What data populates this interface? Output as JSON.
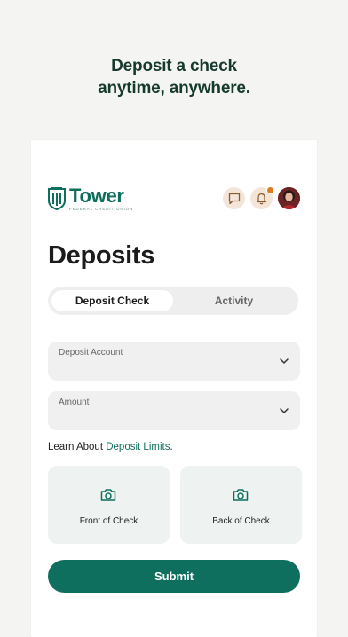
{
  "promo": {
    "line1": "Deposit a check",
    "line2": "anytime, anywhere."
  },
  "header": {
    "brand": "Tower",
    "brand_sub": "FEDERAL CREDIT UNION",
    "icons": [
      "chat-icon",
      "bell-icon",
      "avatar"
    ],
    "notification_dot_color": "#e07a1f"
  },
  "page": {
    "title": "Deposits"
  },
  "tabs": [
    {
      "label": "Deposit Check",
      "active": true
    },
    {
      "label": "Activity",
      "active": false
    }
  ],
  "form": {
    "account_label": "Deposit Account",
    "amount_label": "Amount"
  },
  "learn": {
    "prefix": "Learn About ",
    "link": "Deposit Limits",
    "suffix": "."
  },
  "capture": {
    "front_label": "Front of Check",
    "back_label": "Back of Check"
  },
  "submit_label": "Submit",
  "colors": {
    "brand": "#0f6f5e",
    "background": "#f4f4f3",
    "accent_bg": "#f3e5d8"
  }
}
